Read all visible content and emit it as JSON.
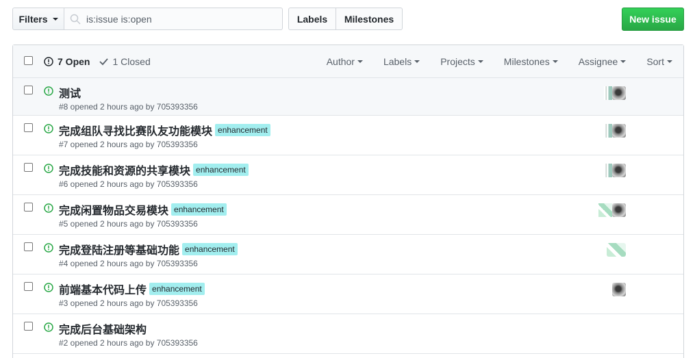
{
  "toolbar": {
    "filters_label": "Filters",
    "search_value": "is:issue is:open",
    "labels_label": "Labels",
    "milestones_label": "Milestones",
    "new_issue_label": "New issue"
  },
  "header": {
    "open_count": "7 Open",
    "closed_count": "1 Closed",
    "filters": [
      "Author",
      "Labels",
      "Projects",
      "Milestones",
      "Assignee",
      "Sort"
    ]
  },
  "issues": [
    {
      "title": "测试",
      "label": "",
      "meta": "#8 opened 2 hours ago by 705393356"
    },
    {
      "title": "完成组队寻找比赛队友功能模块",
      "label": "enhancement",
      "meta": "#7 opened 2 hours ago by 705393356"
    },
    {
      "title": "完成技能和资源的共享模块",
      "label": "enhancement",
      "meta": "#6 opened 2 hours ago by 705393356"
    },
    {
      "title": "完成闲置物品交易模块",
      "label": "enhancement",
      "meta": "#5 opened 2 hours ago by 705393356"
    },
    {
      "title": "完成登陆注册等基础功能",
      "label": "enhancement",
      "meta": "#4 opened 2 hours ago by 705393356"
    },
    {
      "title": "前端基本代码上传",
      "label": "enhancement",
      "meta": "#3 opened 2 hours ago by 705393356"
    },
    {
      "title": "完成后台基础架构",
      "label": "",
      "meta": "#2 opened 2 hours ago by 705393356"
    }
  ],
  "colors": {
    "open_icon": "#28a745",
    "label_bg": "#a2eeef",
    "new_issue_bg": "#2ea44f"
  }
}
